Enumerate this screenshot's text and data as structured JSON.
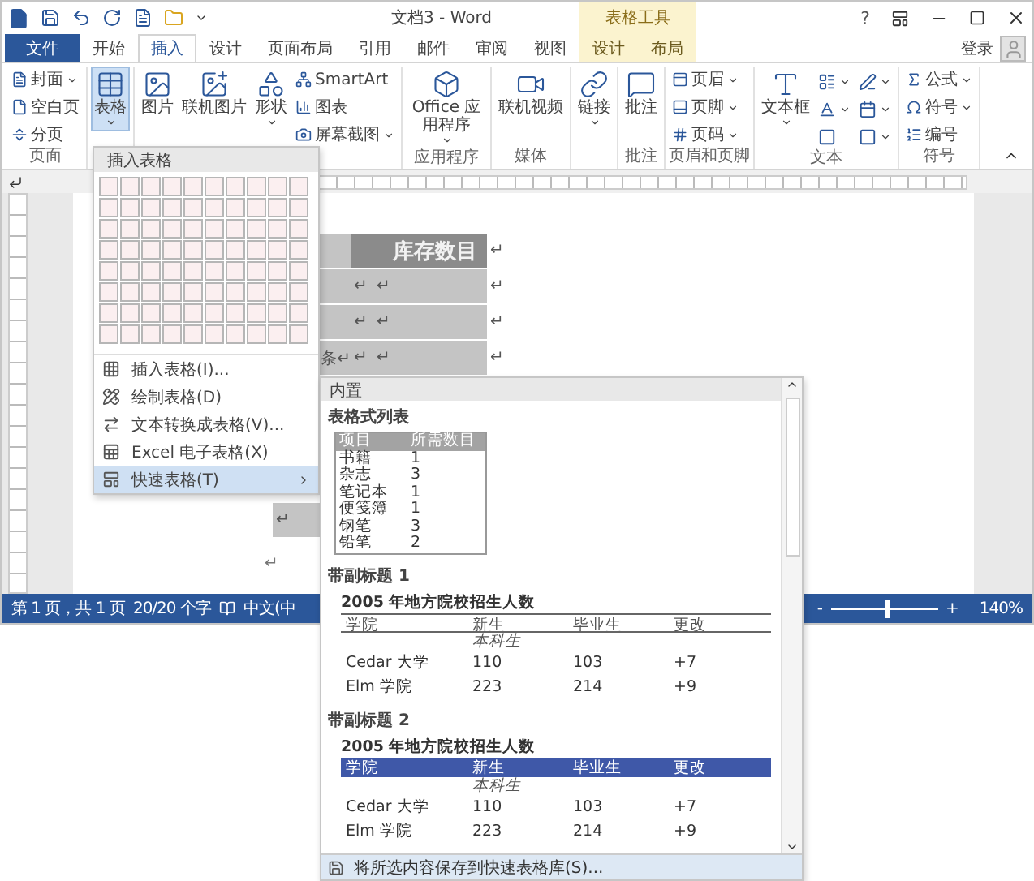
{
  "title_bar": {
    "title": "文档3 - Word",
    "context_header": "表格工具",
    "help": "?",
    "login": "登录"
  },
  "tabs": [
    {
      "label": "文件",
      "kind": "file",
      "selected": false
    },
    {
      "label": "开始",
      "kind": "normal",
      "selected": false
    },
    {
      "label": "插入",
      "kind": "normal",
      "selected": true
    },
    {
      "label": "设计",
      "kind": "normal",
      "selected": false
    },
    {
      "label": "页面布局",
      "kind": "normal",
      "selected": false
    },
    {
      "label": "引用",
      "kind": "normal",
      "selected": false
    },
    {
      "label": "邮件",
      "kind": "normal",
      "selected": false
    },
    {
      "label": "审阅",
      "kind": "normal",
      "selected": false
    },
    {
      "label": "视图",
      "kind": "normal",
      "selected": false
    },
    {
      "label": "设计",
      "kind": "context",
      "selected": false
    },
    {
      "label": "布局",
      "kind": "context",
      "selected": false
    }
  ],
  "ribbon": {
    "groups": [
      {
        "label": "页面",
        "items": [
          {
            "kind": "small",
            "label": "封面",
            "dropdown": true,
            "pressed": false
          },
          {
            "kind": "small",
            "label": "空白页",
            "dropdown": false,
            "pressed": false
          },
          {
            "kind": "small",
            "label": "分页",
            "dropdown": false,
            "pressed": false
          }
        ]
      },
      {
        "items": [
          {
            "kind": "large",
            "label": "表格",
            "dropdown": true,
            "pressed": true
          }
        ]
      },
      {
        "items": [
          {
            "kind": "large",
            "label": "图片",
            "dropdown": false,
            "pressed": false
          },
          {
            "kind": "large",
            "label": "联机图片",
            "dropdown": false,
            "pressed": false
          },
          {
            "kind": "large",
            "label": "形状",
            "dropdown": true,
            "pressed": false
          },
          {
            "kind": "small",
            "label": "SmartArt",
            "dropdown": false,
            "pressed": false
          },
          {
            "kind": "small",
            "label": "图表",
            "dropdown": false,
            "pressed": false
          },
          {
            "kind": "small",
            "label": "屏幕截图",
            "dropdown": true,
            "pressed": false
          }
        ]
      },
      {
        "label": "应用程序",
        "items": [
          {
            "kind": "large",
            "label": "Office 应用程序",
            "dropdown": true,
            "pressed": false
          }
        ]
      },
      {
        "label": "媒体",
        "items": [
          {
            "kind": "large",
            "label": "联机视频",
            "dropdown": false,
            "pressed": false
          }
        ]
      },
      {
        "items": [
          {
            "kind": "large",
            "label": "链接",
            "dropdown": true,
            "pressed": false
          }
        ]
      },
      {
        "label": "批注",
        "items": [
          {
            "kind": "large",
            "label": "批注",
            "dropdown": false,
            "pressed": false
          }
        ]
      },
      {
        "label": "页眉和页脚",
        "items": [
          {
            "kind": "small",
            "label": "页眉",
            "dropdown": true,
            "pressed": false
          },
          {
            "kind": "small",
            "label": "页脚",
            "dropdown": true,
            "pressed": false
          },
          {
            "kind": "small",
            "label": "页码",
            "dropdown": true,
            "pressed": false
          }
        ]
      },
      {
        "label": "文本",
        "items": [
          {
            "kind": "large",
            "label": "文本框",
            "dropdown": true,
            "pressed": false
          },
          {
            "kind": "icon",
            "dropdown": true,
            "pressed": false
          },
          {
            "kind": "icon",
            "dropdown": true,
            "pressed": false
          },
          {
            "kind": "icon",
            "dropdown": true,
            "pressed": false
          },
          {
            "kind": "icon",
            "dropdown": true,
            "pressed": false
          },
          {
            "kind": "icon",
            "dropdown": false,
            "pressed": false
          },
          {
            "kind": "icon",
            "dropdown": true,
            "pressed": false
          }
        ]
      },
      {
        "label": "符号",
        "items": [
          {
            "kind": "small",
            "label": "公式",
            "dropdown": true,
            "pressed": false
          },
          {
            "kind": "small",
            "label": "符号",
            "dropdown": true,
            "pressed": false
          },
          {
            "kind": "small",
            "label": "编号",
            "dropdown": false,
            "pressed": false
          }
        ]
      }
    ]
  },
  "doc": {
    "table": {
      "header": "库存数目",
      "header_mark": "↵",
      "rows": [
        {
          "first": "",
          "marks": [
            "↵",
            "↵",
            "↵"
          ]
        },
        {
          "marks": [
            "↵",
            "↵",
            "↵"
          ]
        },
        {
          "first": "条↵",
          "marks": [
            "↵",
            "↵",
            "↵"
          ]
        }
      ],
      "last_row_mark": "↵"
    },
    "after_mark": "↵"
  },
  "table_menu": {
    "header": "插入表格",
    "items": [
      {
        "label": "插入表格(I)...",
        "selected": false,
        "submenu": false
      },
      {
        "label": "绘制表格(D)",
        "selected": false,
        "submenu": false
      },
      {
        "label": "文本转换成表格(V)...",
        "selected": false,
        "submenu": false
      },
      {
        "label": "Excel 电子表格(X)",
        "selected": false,
        "submenu": false
      },
      {
        "label": "快速表格(T)",
        "selected": true,
        "submenu": true
      }
    ]
  },
  "gallery": {
    "header": "内置",
    "sections": [
      {
        "kind": "list",
        "title": "表格式列表",
        "columns": [
          "项目",
          "所需数目"
        ],
        "rows": [
          [
            "书籍",
            "1"
          ],
          [
            "杂志",
            "3"
          ],
          [
            "笔记本",
            "1"
          ],
          [
            "便笺簿",
            "1"
          ],
          [
            "钢笔",
            "3"
          ],
          [
            "铅笔",
            "2"
          ]
        ]
      },
      {
        "kind": "plain",
        "title": "带副标题 1",
        "caption": "2005 年地方院校招生人数",
        "columns": [
          "学院",
          "新生",
          "毕业生",
          "更改"
        ],
        "subheader": "本科生",
        "rows": [
          [
            "Cedar 大学",
            "110",
            "103",
            "+7"
          ],
          [
            "Elm 学院",
            "223",
            "214",
            "+9"
          ]
        ]
      },
      {
        "kind": "filled",
        "title": "带副标题 2",
        "caption": "2005 年地方院校招生人数",
        "columns": [
          "学院",
          "新生",
          "毕业生",
          "更改"
        ],
        "subheader": "本科生",
        "rows": [
          [
            "Cedar 大学",
            "110",
            "103",
            "+7"
          ],
          [
            "Elm 学院",
            "223",
            "214",
            "+9"
          ]
        ]
      }
    ],
    "footer": "将所选内容保存到快速表格库(S)..."
  },
  "status_bar": {
    "items": [
      "第 1 页，共 1 页",
      "20/20 个字"
    ],
    "language": "中文(中",
    "zoom": {
      "zoom_out": "-",
      "zoom_in": "+",
      "level": 0.53,
      "value": "140%"
    }
  }
}
